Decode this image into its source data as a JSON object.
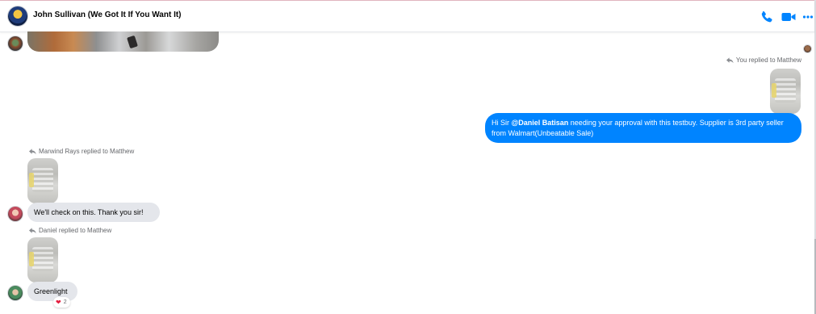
{
  "header": {
    "title": "John Sullivan (We Got It If You Want It)",
    "icons": [
      "phone-icon",
      "video-camera-icon",
      "more-options-icon"
    ],
    "accent_color": "#0084ff"
  },
  "messages": [
    {
      "sender": "you",
      "reply_label": "You replied to Matthew",
      "text_prefix": "Hi Sir ",
      "mention": "@Daniel Batisan",
      "text_suffix": " needing your approval with this testbuy. Supplier is 3rd party seller from Walmart(Unbeatable Sale)"
    },
    {
      "sender": "Marwind Rays",
      "reply_label": "Marwind Rays replied to Matthew",
      "text": "We'll check on this. Thank you sir!"
    },
    {
      "sender": "Daniel",
      "reply_label": "Daniel replied to Matthew",
      "text": "Greenlight",
      "reaction": {
        "icon": "heart-icon",
        "count": "2"
      }
    }
  ],
  "colors": {
    "outgoing_bubble": "#0084ff",
    "incoming_bubble": "#e4e6eb",
    "meta_text": "#65676b"
  }
}
